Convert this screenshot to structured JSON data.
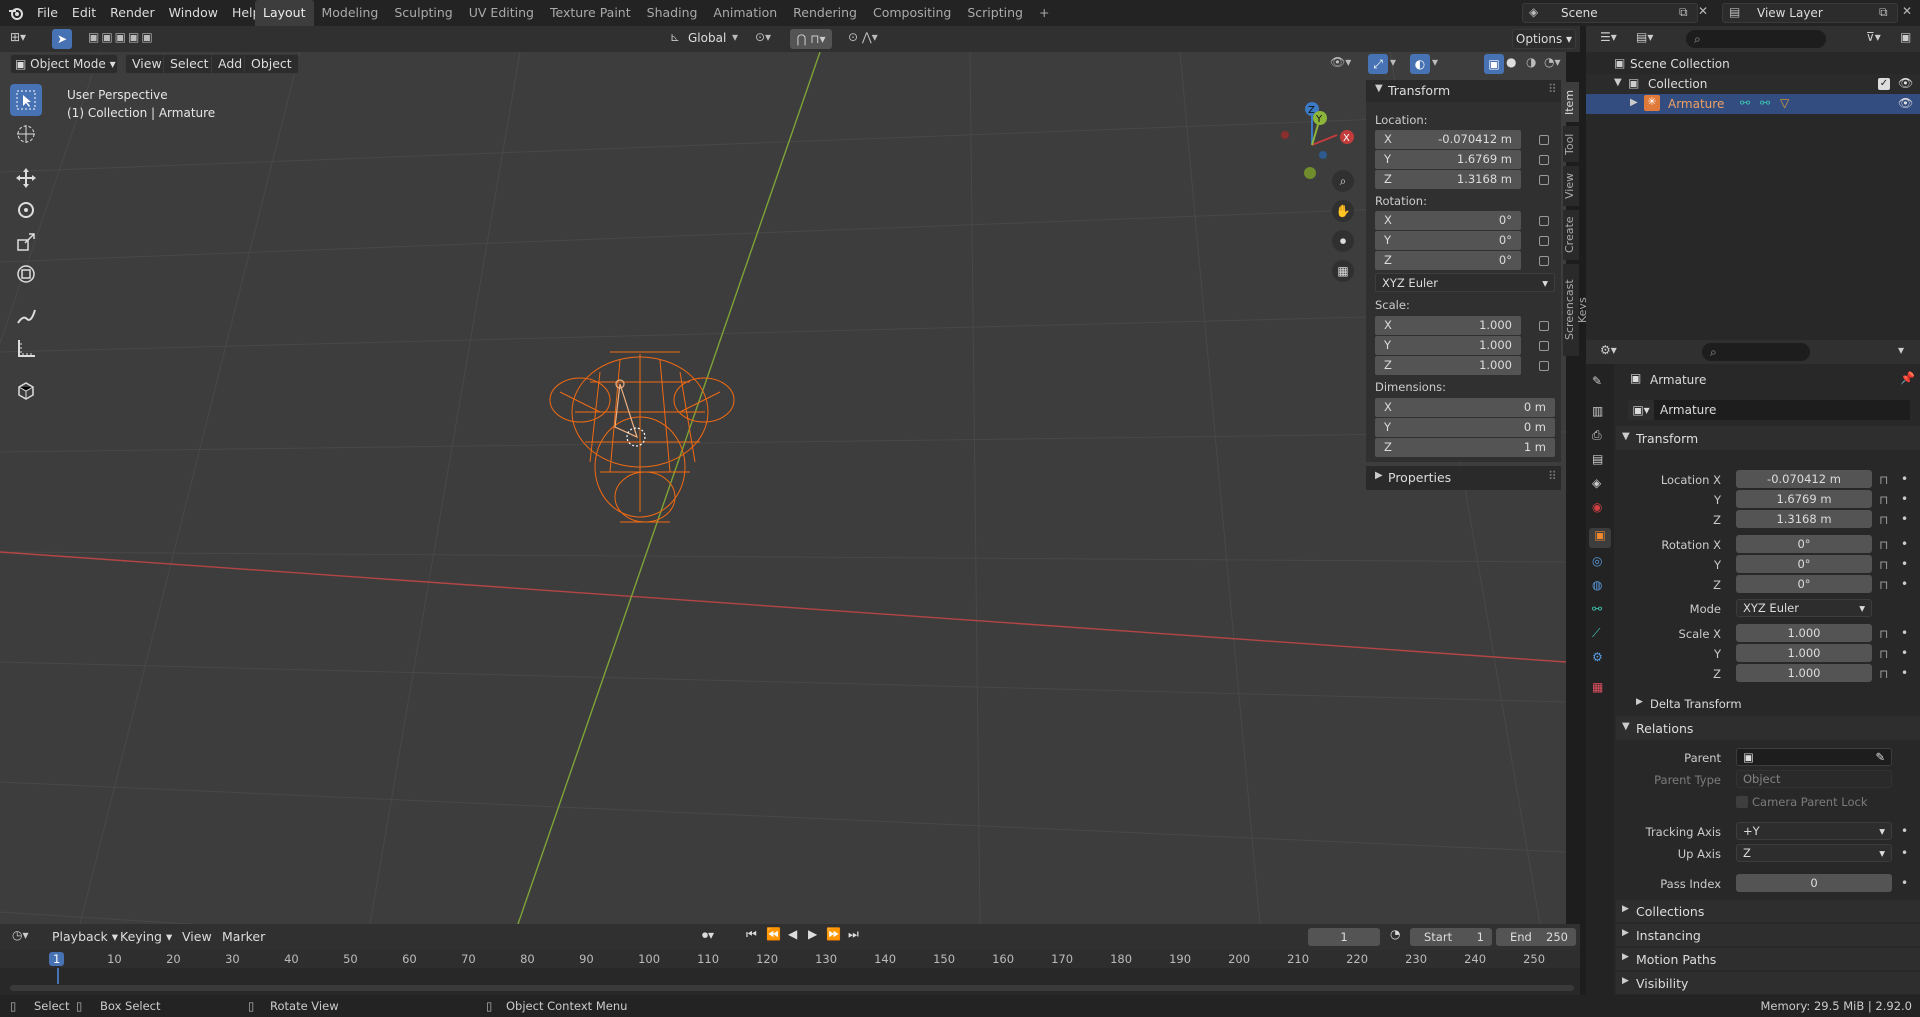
{
  "topbar": {
    "menus": [
      "File",
      "Edit",
      "Render",
      "Window",
      "Help"
    ],
    "workspaces": [
      "Layout",
      "Modeling",
      "Sculpting",
      "UV Editing",
      "Texture Paint",
      "Shading",
      "Animation",
      "Rendering",
      "Compositing",
      "Scripting"
    ],
    "scene": "Scene",
    "view_layer": "View Layer"
  },
  "viewport_header": {
    "mode": "Object Mode",
    "menus": [
      "View",
      "Select",
      "Add",
      "Object"
    ],
    "transform_orientation": "Global",
    "options": "Options"
  },
  "viewport": {
    "perspective": "User Perspective",
    "collection_info": "(1) Collection | Armature",
    "gizmo_axes": [
      "Z",
      "Y",
      "X"
    ]
  },
  "npanel": {
    "title": "Transform",
    "location_label": "Location:",
    "location": [
      {
        "axis": "X",
        "value": "-0.070412 m"
      },
      {
        "axis": "Y",
        "value": "1.6769 m"
      },
      {
        "axis": "Z",
        "value": "1.3168 m"
      }
    ],
    "rotation_label": "Rotation:",
    "rotation": [
      {
        "axis": "X",
        "value": "0°"
      },
      {
        "axis": "Y",
        "value": "0°"
      },
      {
        "axis": "Z",
        "value": "0°"
      }
    ],
    "rotation_mode": "XYZ Euler",
    "scale_label": "Scale:",
    "scale": [
      {
        "axis": "X",
        "value": "1.000"
      },
      {
        "axis": "Y",
        "value": "1.000"
      },
      {
        "axis": "Z",
        "value": "1.000"
      }
    ],
    "dimensions_label": "Dimensions:",
    "dimensions": [
      {
        "axis": "X",
        "value": "0 m"
      },
      {
        "axis": "Y",
        "value": "0 m"
      },
      {
        "axis": "Z",
        "value": "1 m"
      }
    ],
    "properties": "Properties",
    "tabs": [
      "Item",
      "Tool",
      "View",
      "Create",
      "Screencast Keys"
    ]
  },
  "outliner": {
    "root": "Scene Collection",
    "collection": "Collection",
    "object": "Armature"
  },
  "properties": {
    "object_name": "Armature",
    "name_field": "Armature",
    "transform": "Transform",
    "location_x_label": "Location X",
    "location": [
      "-0.070412 m",
      "1.6769 m",
      "1.3168 m"
    ],
    "rotation_x_label": "Rotation X",
    "rotation": [
      "0°",
      "0°",
      "0°"
    ],
    "mode_label": "Mode",
    "mode": "XYZ Euler",
    "scale_x_label": "Scale X",
    "scale": [
      "1.000",
      "1.000",
      "1.000"
    ],
    "y_label": "Y",
    "z_label": "Z",
    "delta_transform": "Delta Transform",
    "relations": "Relations",
    "parent_label": "Parent",
    "parent_type_label": "Parent Type",
    "parent_type": "Object",
    "camera_parent_lock": "Camera Parent Lock",
    "tracking_axis_label": "Tracking Axis",
    "tracking_axis": "+Y",
    "up_axis_label": "Up Axis",
    "up_axis": "Z",
    "pass_index_label": "Pass Index",
    "pass_index": "0",
    "collections": "Collections",
    "instancing": "Instancing",
    "motion_paths": "Motion Paths",
    "visibility": "Visibility"
  },
  "timeline": {
    "menus": [
      "Playback",
      "Keying",
      "View",
      "Marker"
    ],
    "current_frame": "1",
    "start_label": "Start",
    "start": "1",
    "end_label": "End",
    "end": "250",
    "ruler": [
      "1",
      "10",
      "20",
      "30",
      "40",
      "50",
      "60",
      "70",
      "80",
      "90",
      "100",
      "110",
      "120",
      "130",
      "140",
      "150",
      "160",
      "170",
      "180",
      "190",
      "200",
      "210",
      "220",
      "230",
      "240",
      "250"
    ]
  },
  "statusbar": {
    "select": "Select",
    "box_select": "Box Select",
    "rotate_view": "Rotate View",
    "context_menu": "Object Context Menu",
    "memory": "Memory: 29.5 MiB | 2.92.0"
  },
  "colors": {
    "accent": "#4772b3",
    "selection": "#ff7a1f",
    "axis_x": "#c33c3c",
    "axis_y": "#8db53b",
    "axis_z": "#3c7ac3"
  }
}
